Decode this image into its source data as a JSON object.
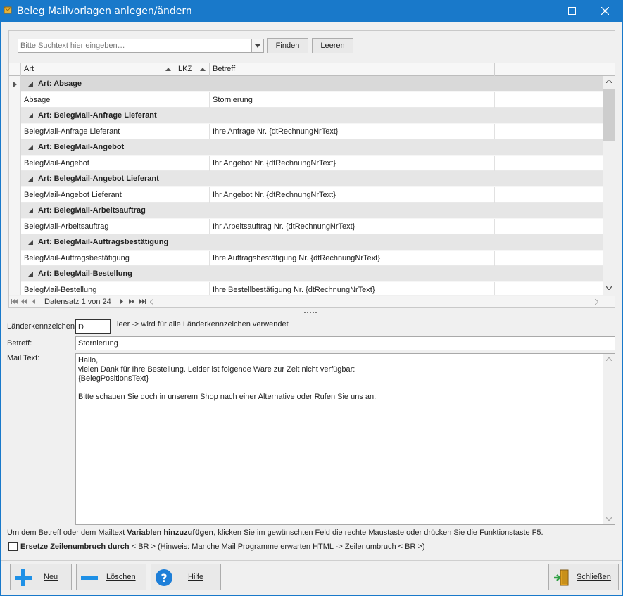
{
  "window": {
    "title": "Beleg Mailvorlagen anlegen/ändern"
  },
  "search": {
    "placeholder": "Bitte Suchtext hier eingeben…",
    "find_label": "Finden",
    "clear_label": "Leeren"
  },
  "grid": {
    "columns": [
      "Art",
      "LKZ",
      "Betreff"
    ],
    "group_prefix": "Art: ",
    "groups": [
      {
        "group": "Absage",
        "art": "Absage",
        "lkz": "",
        "betreff": "Stornierung"
      },
      {
        "group": "BelegMail-Anfrage Lieferant",
        "art": "BelegMail-Anfrage Lieferant",
        "lkz": "",
        "betreff": "Ihre Anfrage Nr. {dtRechnungNrText}"
      },
      {
        "group": "BelegMail-Angebot",
        "art": "BelegMail-Angebot",
        "lkz": "",
        "betreff": "Ihr Angebot Nr. {dtRechnungNrText}"
      },
      {
        "group": "BelegMail-Angebot Lieferant",
        "art": "BelegMail-Angebot Lieferant",
        "lkz": "",
        "betreff": "Ihr Angebot Nr. {dtRechnungNrText}"
      },
      {
        "group": "BelegMail-Arbeitsauftrag",
        "art": "BelegMail-Arbeitsauftrag",
        "lkz": "",
        "betreff": "Ihr Arbeitsauftrag Nr. {dtRechnungNrText}"
      },
      {
        "group": "BelegMail-Auftragsbestätigung",
        "art": "BelegMail-Auftragsbestätigung",
        "lkz": "",
        "betreff": "Ihre Auftragsbestätigung Nr. {dtRechnungNrText}"
      },
      {
        "group": "BelegMail-Bestellung",
        "art": "BelegMail-Bestellung",
        "lkz": "",
        "betreff": "Ihre Bestellbestätigung Nr. {dtRechnungNrText}"
      }
    ],
    "navigator": "Datensatz 1 von 24"
  },
  "form": {
    "lkz_label": "Länderkennzeichen",
    "lkz_value": "D",
    "lkz_hint": "leer -> wird für alle Länderkennzeichen verwendet",
    "betreff_label": "Betreff:",
    "betreff_value": "Stornierung",
    "mailtext_label": "Mail Text:",
    "mailtext_value": "Hallo,\nvielen Dank für Ihre Bestellung. Leider ist folgende Ware zur Zeit nicht verfügbar:\n{BelegPositionsText}\n\nBitte schauen Sie doch in unserem Shop nach einer Alternative oder Rufen Sie uns an."
  },
  "hint": {
    "pre": "Um dem Betreff oder dem Mailtext ",
    "bold": "Variablen hinzuzufügen",
    "post": ", klicken Sie im gewünschten Feld die rechte Maustaste oder drücken Sie die Funktionstaste F5."
  },
  "checkbox": {
    "bold": "Ersetze Zeilenumbruch durch",
    "rest": " < BR > (Hinweis: Manche Mail Programme erwarten HTML -> Zeilenumbruch < BR >)",
    "checked": false
  },
  "buttons": {
    "new": "Neu",
    "delete": "Löschen",
    "help": "Hilfe",
    "close": "Schließen"
  },
  "colors": {
    "titlebar": "#1979ca",
    "new_icon": "#1e90e6",
    "help_icon": "#1e7fd8"
  }
}
